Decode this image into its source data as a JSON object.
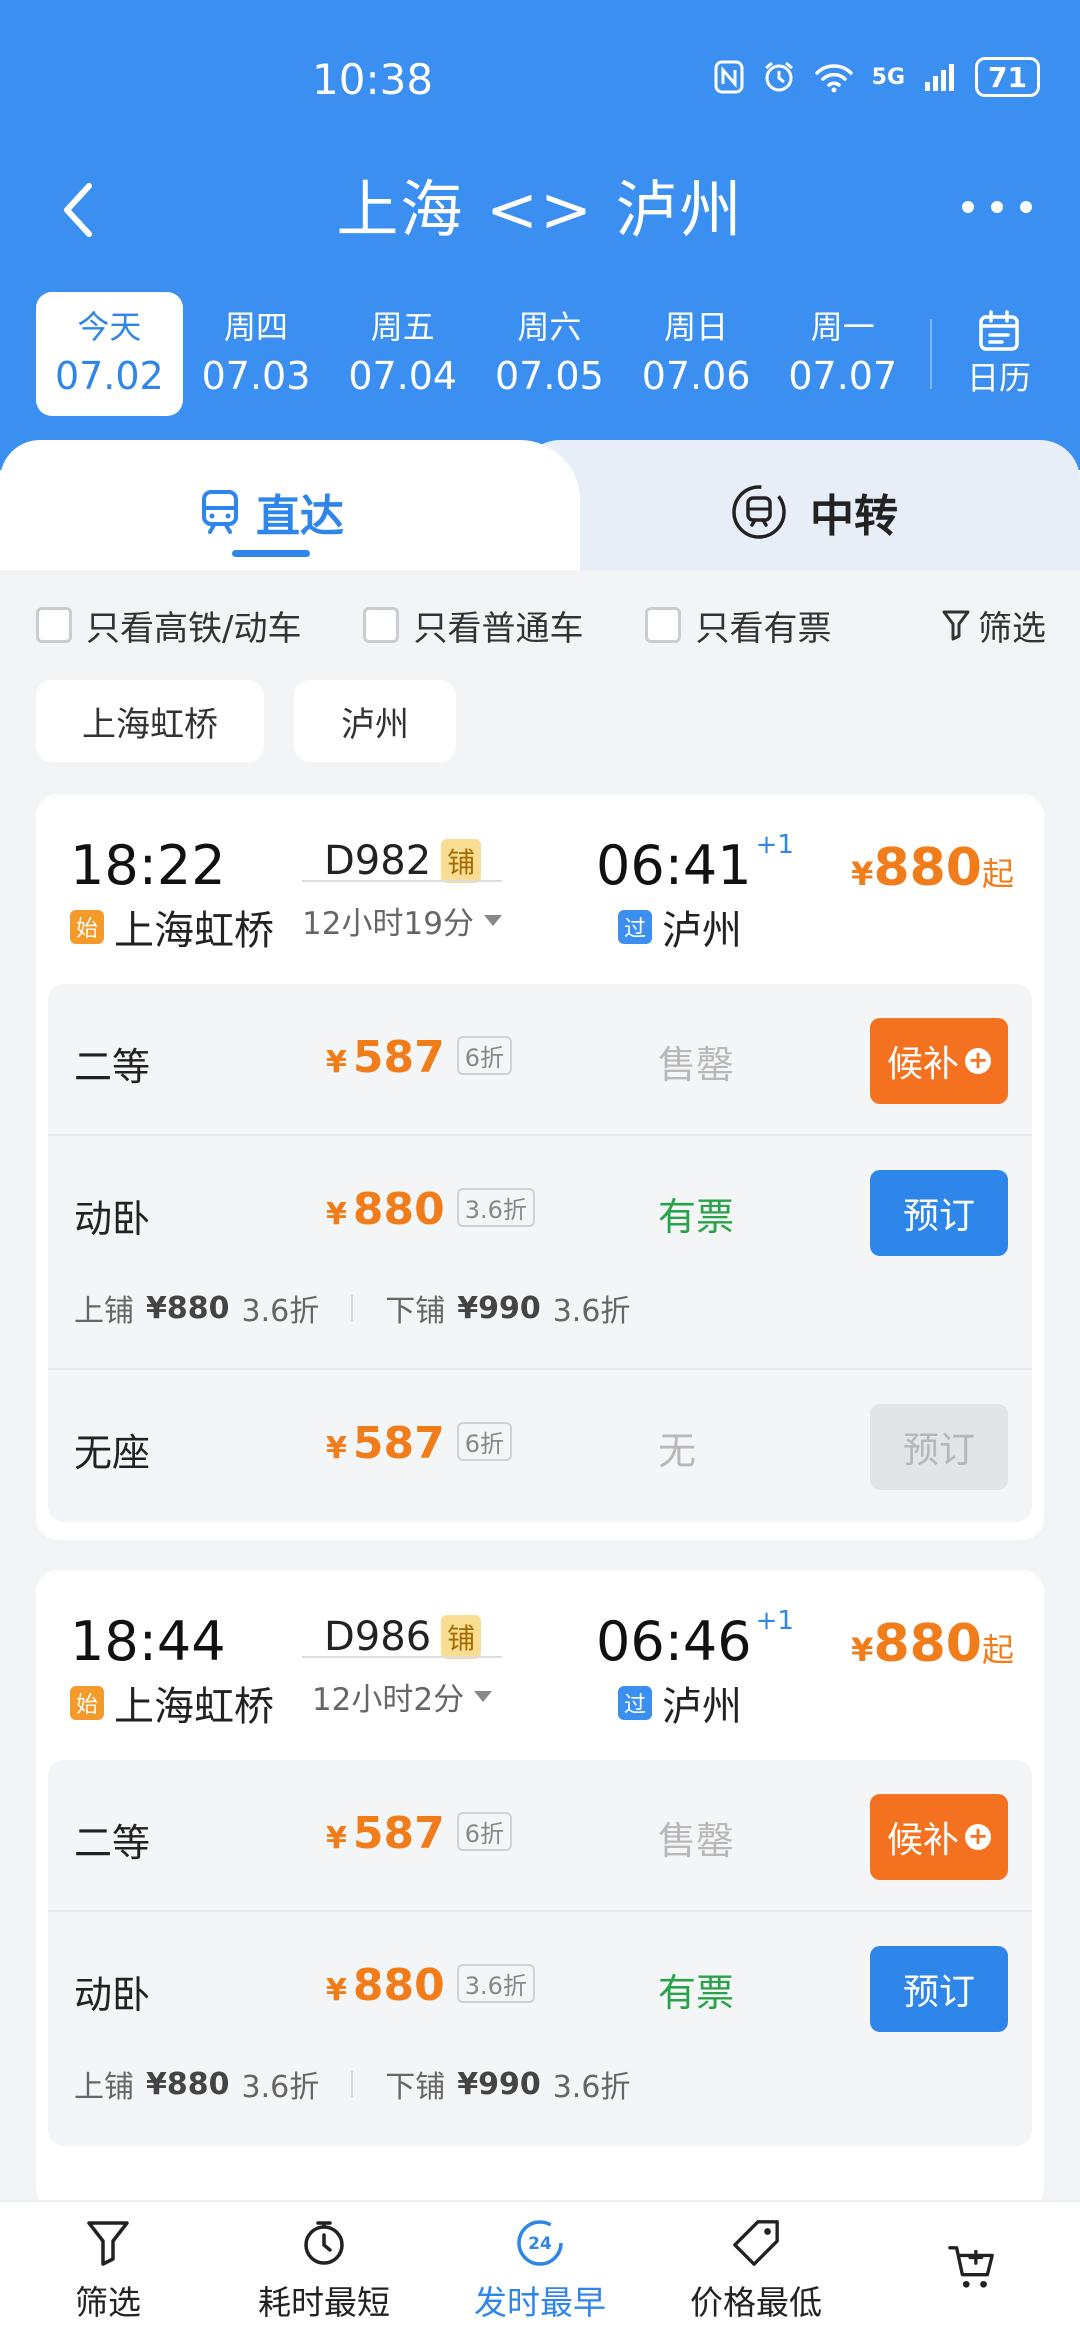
{
  "status_bar": {
    "time": "10:38",
    "network": "5G",
    "battery": "71",
    "icons": [
      "nfc-icon",
      "alarm-icon",
      "wifi-icon",
      "signal-icon",
      "battery-icon"
    ]
  },
  "header": {
    "title": "上海 <> 泸州",
    "back_icon": "back-arrow-icon",
    "more_icon": "more-dots-icon"
  },
  "dates": [
    {
      "dow": "今天",
      "date": "07.02",
      "active": true
    },
    {
      "dow": "周四",
      "date": "07.03"
    },
    {
      "dow": "周五",
      "date": "07.04"
    },
    {
      "dow": "周六",
      "date": "07.05"
    },
    {
      "dow": "周日",
      "date": "07.06"
    },
    {
      "dow": "周一",
      "date": "07.07"
    }
  ],
  "calendar_label": "日历",
  "mode_tabs": {
    "direct": "直达",
    "transfer": "中转"
  },
  "filters": {
    "high_speed": "只看高铁/动车",
    "normal": "只看普通车",
    "available": "只看有票",
    "filter": "筛选"
  },
  "stations": [
    "上海虹桥",
    "泸州"
  ],
  "trains": [
    {
      "dep_time": "18:22",
      "train_no": "D982",
      "tag": "铺",
      "duration": "12小时19分",
      "arr_time": "06:41",
      "arr_day": "+1",
      "from_badge": "始",
      "from": "上海虹桥",
      "to_badge": "过",
      "to": "泸州",
      "min_price_yen": "¥",
      "min_price": "880",
      "min_price_suffix": "起",
      "seats": [
        {
          "name": "二等",
          "yen": "¥",
          "price": "587",
          "discount": "6折",
          "status": "售罄",
          "action": "候补"
        },
        {
          "name": "动卧",
          "yen": "¥",
          "price": "880",
          "discount": "3.6折",
          "status": "有票",
          "action": "预订",
          "berths": {
            "upper_label": "上铺",
            "upper_price": "¥880",
            "upper_disc": "3.6折",
            "lower_label": "下铺",
            "lower_price": "¥990",
            "lower_disc": "3.6折"
          }
        },
        {
          "name": "无座",
          "yen": "¥",
          "price": "587",
          "discount": "6折",
          "status": "无",
          "action": "预订"
        }
      ]
    },
    {
      "dep_time": "18:44",
      "train_no": "D986",
      "tag": "铺",
      "duration": "12小时2分",
      "arr_time": "06:46",
      "arr_day": "+1",
      "from_badge": "始",
      "from": "上海虹桥",
      "to_badge": "过",
      "to": "泸州",
      "min_price_yen": "¥",
      "min_price": "880",
      "min_price_suffix": "起",
      "seats": [
        {
          "name": "二等",
          "yen": "¥",
          "price": "587",
          "discount": "6折",
          "status": "售罄",
          "action": "候补"
        },
        {
          "name": "动卧",
          "yen": "¥",
          "price": "880",
          "discount": "3.6折",
          "status": "有票",
          "action": "预订",
          "berths": {
            "upper_label": "上铺",
            "upper_price": "¥880",
            "upper_disc": "3.6折",
            "lower_label": "下铺",
            "lower_price": "¥990",
            "lower_disc": "3.6折"
          }
        }
      ]
    }
  ],
  "bottom_nav": [
    {
      "label": "筛选",
      "icon": "funnel-icon"
    },
    {
      "label": "耗时最短",
      "icon": "stopwatch-icon"
    },
    {
      "label": "发时最早",
      "icon": "clock-24-icon",
      "active": true,
      "icon_text": "24"
    },
    {
      "label": "价格最低",
      "icon": "price-tag-icon"
    },
    {
      "label": "",
      "icon": "cart-icon"
    }
  ],
  "colors": {
    "brand_blue": "#3b8ff0",
    "price_orange": "#f07d1a",
    "available_green": "#29a34a",
    "waitlist_orange": "#f4711f"
  }
}
